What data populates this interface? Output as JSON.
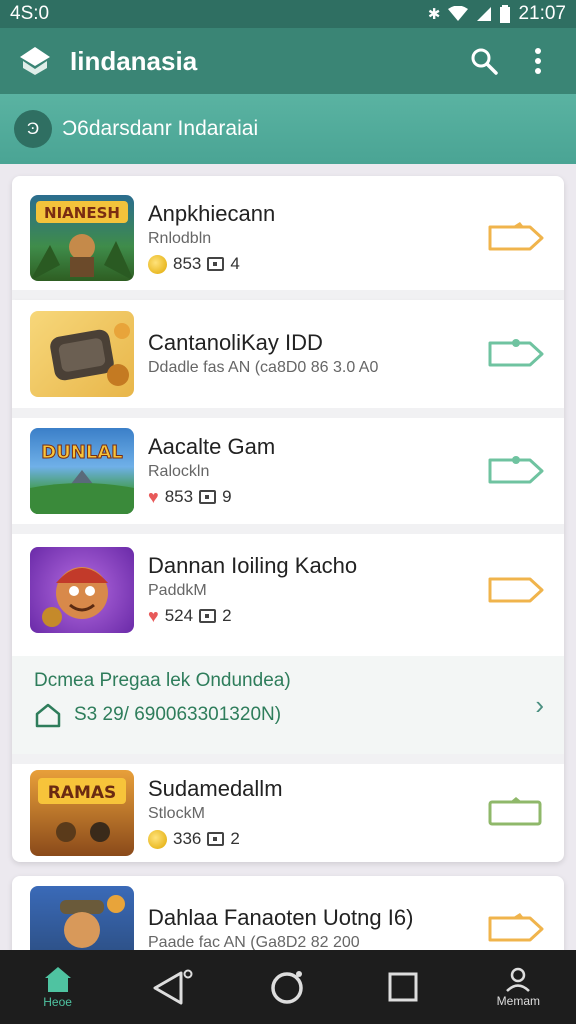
{
  "status": {
    "time": "4S:0",
    "clock": "21:07",
    "icons": [
      "bluetooth-icon",
      "wifi-icon",
      "signal-icon",
      "battery-icon"
    ]
  },
  "app": {
    "title": "Iindanasia",
    "logo_icon": "app-logo-icon",
    "search_icon": "search-icon",
    "menu_icon": "more-vert-icon"
  },
  "subheader": {
    "avatar_text": "Ͽ",
    "text": "Ɔ6darsdanr Indaraiai"
  },
  "items": [
    {
      "title": "Anpkhiecann",
      "sub": "Rnlodbln",
      "meta_icon": "coin-icon",
      "count": "853",
      "extra": "4",
      "thumb_text": "NIANESH",
      "action_color": "#f0b44c"
    },
    {
      "title": "CantanoliKay IDD",
      "sub": "Ddadle fas AN (ca8D0 86 3.0 A0",
      "meta_icon": "",
      "count": "",
      "extra": "",
      "thumb_text": "",
      "action_color": "#6fc3a0"
    },
    {
      "title": "Aacalte Gam",
      "sub": "Ralockln",
      "meta_icon": "heart-icon",
      "count": "853",
      "extra": "9",
      "thumb_text": "DUNLAL",
      "action_color": "#6fc3a0"
    },
    {
      "title": "Dannan Ioiling Kacho",
      "sub": "PaddkM",
      "meta_icon": "heart-icon",
      "count": "524",
      "extra": "2",
      "thumb_text": "",
      "action_color": "#f0b44c"
    },
    {
      "title": "Sudamedallm",
      "sub": "StlockM",
      "meta_icon": "coin-icon",
      "count": "336",
      "extra": "2",
      "thumb_text": "RAMAS",
      "action_color": "#8fb86a"
    },
    {
      "title": "Dahlaa Fanaoten Uotng I6)",
      "sub": "Paade fac AN (Ga8D2 82 200",
      "meta_icon": "",
      "count": "",
      "extra": "",
      "thumb_text": "",
      "action_color": "#f0b44c"
    }
  ],
  "promo": {
    "title": "Dcmea Pregaa lek Ondundea)",
    "line": "S3 29/ 690063301320N)",
    "icon": "home-outline-icon",
    "chevron_icon": "chevron-right-icon"
  },
  "nav": [
    {
      "label": "Heoe",
      "icon": "home-icon"
    },
    {
      "label": "",
      "icon": "back-triangle-icon"
    },
    {
      "label": "",
      "icon": "circle-home-icon"
    },
    {
      "label": "",
      "icon": "recents-square-icon"
    },
    {
      "label": "Memam",
      "icon": "profile-icon"
    }
  ]
}
